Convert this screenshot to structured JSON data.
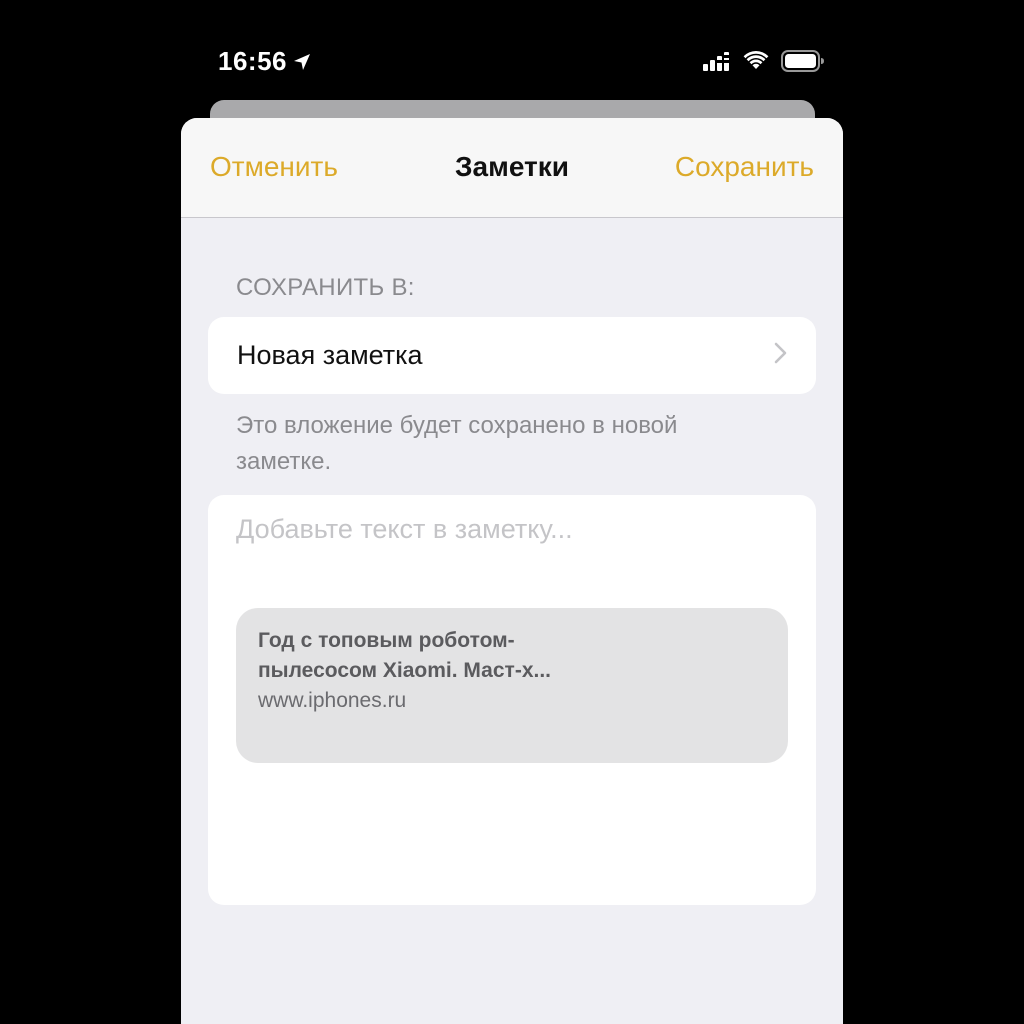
{
  "status_bar": {
    "time": "16:56"
  },
  "navbar": {
    "cancel_label": "Отменить",
    "title": "Заметки",
    "save_label": "Сохранить"
  },
  "save_to": {
    "header": "СОХРАНИТЬ В:",
    "destination": "Новая заметка",
    "footer": "Это вложение будет сохранено в новой заметке."
  },
  "note": {
    "placeholder": "Добавьте текст в заметку...",
    "attachment": {
      "title": "Год с топовым роботом-пылесосом Xiaomi. Маст-х...",
      "url": "www.iphones.ru"
    }
  },
  "colors": {
    "accent": "#dcaa2a",
    "background": "#efeff4",
    "card": "#ffffff",
    "secondary_text": "#8a8a8e"
  },
  "icons": {
    "location": "location-arrow-icon",
    "signal": "cellular-signal-icon",
    "wifi": "wifi-icon",
    "battery": "battery-icon",
    "chevron": "chevron-right-icon"
  }
}
